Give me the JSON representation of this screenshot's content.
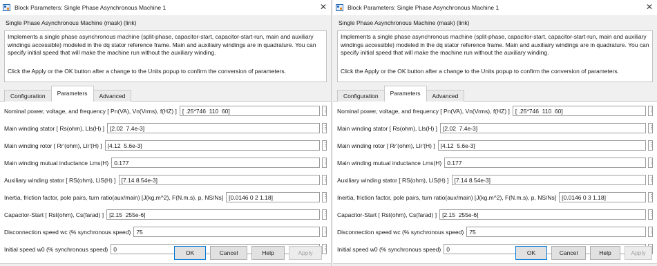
{
  "dialogs": [
    {
      "title": "Block Parameters: Single Phase Asynchronous Machine 1",
      "close_glyph": "✕",
      "mask_name": "Single Phase Asynchronous Machine (mask) (link)",
      "description": "Implements a single phase asynchronous machine (split-phase, capacitor-start, capacitor-start-run, main and auxiliary windings accessible) modeled in the dq stator reference frame. Main and auxiliairy windings are in quadrature. You can specify initial speed that will make the machine run without the auxiliary winding.",
      "note": "Click the Apply or the OK button after a change to the Units popup to confirm the conversion of parameters.",
      "tabs": [
        "Configuration",
        "Parameters",
        "Advanced"
      ],
      "params": [
        {
          "label": "Nominal power, voltage, and frequency [ Pn(VA), Vn(Vrms), f(HZ) ]",
          "value": "[ .25*746  110  60]"
        },
        {
          "label": "Main winding stator [ Rs(ohm), Lls(H) ]",
          "value": "[2.02  7.4e-3]"
        },
        {
          "label": "Main winding rotor [ Rr'(ohm), Llr'(H) ]",
          "value": "[4.12  5.6e-3]"
        },
        {
          "label": "Main winding mutual inductance Lms(H)",
          "value": "0.177"
        },
        {
          "label": "Auxiliary  winding stator [ RS(ohm), LlS(H) ]",
          "value": "[7.14 8.54e-3]"
        },
        {
          "label": "Inertia, friction factor, pole pairs, turn ratio(aux/main) [J(kg.m^2), F(N.m.s), p, NS/Ns]",
          "value": "[0.0146 0 2 1.18]"
        },
        {
          "label": "Capacitor-Start [ Rst(ohm), Cs(farad) ]",
          "value": "[2.15  255e-6]"
        },
        {
          "label": "Disconnection speed wc (% synchronous speed)",
          "value": "75"
        },
        {
          "label": "Initial speed w0 (% synchronous speed)",
          "value": "0"
        }
      ],
      "buttons": {
        "ok": "OK",
        "cancel": "Cancel",
        "help": "Help",
        "apply": "Apply"
      }
    },
    {
      "title": "Block Parameters: Single Phase Asynchronous Machine 1",
      "close_glyph": "✕",
      "mask_name": "Single Phase Asynchronous Machine (mask) (link)",
      "description": "Implements a single phase asynchronous machine (split-phase, capacitor-start, capacitor-start-run, main and auxiliary windings accessible) modeled in the dq stator reference frame. Main and auxiliairy windings are in quadrature. You can specify initial speed that will make the machine run without the auxiliary winding.",
      "note": "Click the Apply or the OK button after a change to the Units popup to confirm the conversion of parameters.",
      "tabs": [
        "Configuration",
        "Parameters",
        "Advanced"
      ],
      "params": [
        {
          "label": "Nominal power, voltage, and frequency [ Pn(VA), Vn(Vrms), f(HZ) ]",
          "value": "[ .25*746  110  60]"
        },
        {
          "label": "Main winding stator [ Rs(ohm), Lls(H) ]",
          "value": "[2.02  7.4e-3]"
        },
        {
          "label": "Main winding rotor [ Rr'(ohm), Llr'(H) ]",
          "value": "[4.12  5.6e-3]"
        },
        {
          "label": "Main winding mutual inductance Lms(H)",
          "value": "0.177"
        },
        {
          "label": "Auxiliary  winding stator [ RS(ohm), LlS(H) ]",
          "value": "[7.14 8.54e-3]"
        },
        {
          "label": "Inertia, friction factor, pole pairs, turn ratio(aux/main) [J(kg.m^2), F(N.m.s), p, NS/Ns]",
          "value": "[0.0146 0 3 1.18]"
        },
        {
          "label": "Capacitor-Start [ Rst(ohm), Cs(farad) ]",
          "value": "[2.15  255e-6]"
        },
        {
          "label": "Disconnection speed wc (% synchronous speed)",
          "value": "75"
        },
        {
          "label": "Initial speed w0 (% synchronous speed)",
          "value": "0"
        }
      ],
      "buttons": {
        "ok": "OK",
        "cancel": "Cancel",
        "help": "Help",
        "apply": "Apply"
      }
    }
  ]
}
